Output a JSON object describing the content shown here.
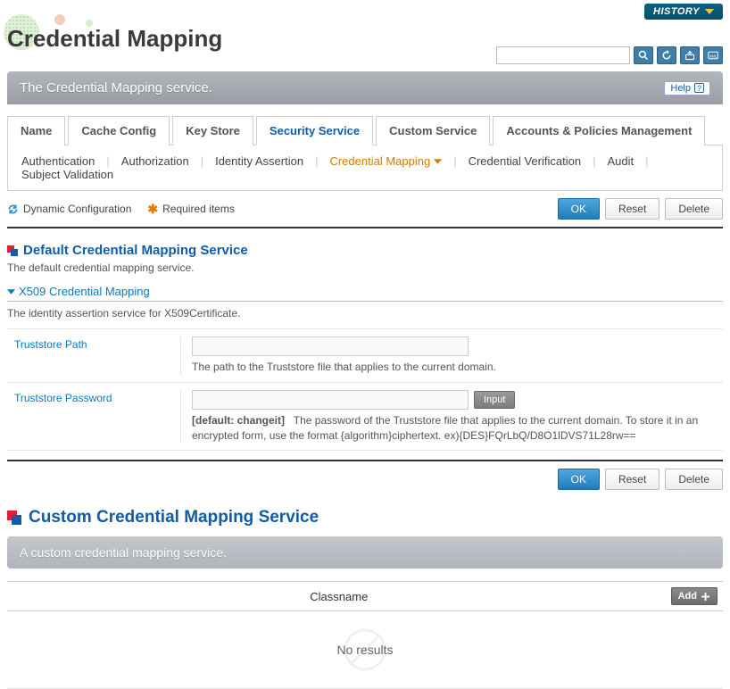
{
  "header": {
    "history_label": "HISTORY",
    "title": "Credential Mapping"
  },
  "banner": {
    "text": "The Credential Mapping service.",
    "help_label": "Help"
  },
  "tabs": [
    {
      "label": "Name"
    },
    {
      "label": "Cache Config"
    },
    {
      "label": "Key Store"
    },
    {
      "label": "Security Service",
      "active": true
    },
    {
      "label": "Custom Service"
    },
    {
      "label": "Accounts & Policies Management"
    }
  ],
  "subtabs": [
    {
      "label": "Authentication"
    },
    {
      "label": "Authorization"
    },
    {
      "label": "Identity Assertion"
    },
    {
      "label": "Credential Mapping",
      "active": true
    },
    {
      "label": "Credential Verification"
    },
    {
      "label": "Audit"
    },
    {
      "label": "Subject Validation"
    }
  ],
  "toolbar": {
    "dynamic_label": "Dynamic Configuration",
    "required_label": "Required items",
    "ok": "OK",
    "reset": "Reset",
    "delete": "Delete"
  },
  "default_section": {
    "title": "Default Credential Mapping Service",
    "desc": "The default credential mapping service.",
    "expander_label": "X509 Credential Mapping",
    "expander_desc": "The identity assertion service for X509Certificate.",
    "fields": {
      "truststore_path": {
        "label": "Truststore Path",
        "value": "",
        "hint": "The path to the Truststore file that applies to the current domain."
      },
      "truststore_password": {
        "label": "Truststore Password",
        "value": "",
        "input_btn": "Input",
        "default_tag": "[default: changeit]",
        "hint": "The password of the Truststore file that applies to the current domain. To store it in an encrypted form, use the format {algorithm}ciphertext. ex){DES}FQrLbQ/D8O1lDVS71L28rw=="
      }
    }
  },
  "actions2": {
    "ok": "OK",
    "reset": "Reset",
    "delete": "Delete"
  },
  "custom_section": {
    "title": "Custom Credential Mapping Service",
    "banner": "A custom credential mapping service.",
    "column": "Classname",
    "add_label": "Add",
    "empty": "No results"
  }
}
